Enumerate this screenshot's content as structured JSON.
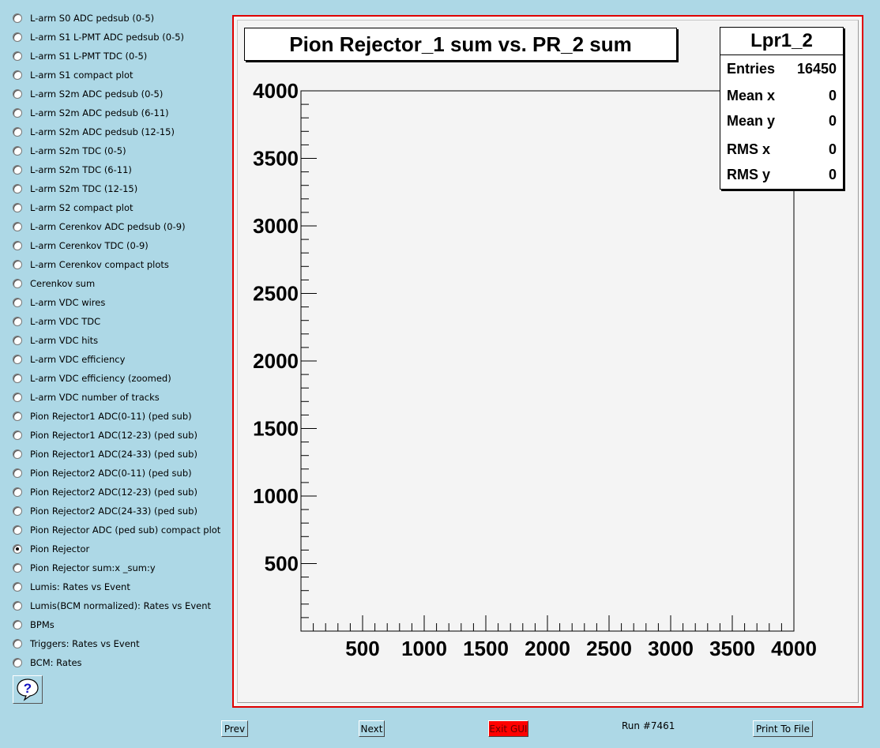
{
  "radio_items": [
    {
      "label": "L-arm S0 ADC pedsub (0-5)",
      "checked": false
    },
    {
      "label": "L-arm S1 L-PMT ADC pedsub (0-5)",
      "checked": false
    },
    {
      "label": "L-arm S1 L-PMT TDC (0-5)",
      "checked": false
    },
    {
      "label": "L-arm S1 compact plot",
      "checked": false
    },
    {
      "label": "L-arm S2m ADC pedsub (0-5)",
      "checked": false
    },
    {
      "label": "L-arm S2m ADC pedsub (6-11)",
      "checked": false
    },
    {
      "label": "L-arm S2m ADC pedsub (12-15)",
      "checked": false
    },
    {
      "label": "L-arm S2m TDC (0-5)",
      "checked": false
    },
    {
      "label": "L-arm S2m TDC (6-11)",
      "checked": false
    },
    {
      "label": "L-arm S2m TDC (12-15)",
      "checked": false
    },
    {
      "label": "L-arm S2 compact plot",
      "checked": false
    },
    {
      "label": "L-arm Cerenkov ADC pedsub (0-9)",
      "checked": false
    },
    {
      "label": "L-arm Cerenkov TDC (0-9)",
      "checked": false
    },
    {
      "label": "L-arm Cerenkov compact plots",
      "checked": false
    },
    {
      "label": "Cerenkov sum",
      "checked": false
    },
    {
      "label": "L-arm VDC wires",
      "checked": false
    },
    {
      "label": "L-arm VDC TDC",
      "checked": false
    },
    {
      "label": "L-arm VDC hits",
      "checked": false
    },
    {
      "label": "L-arm VDC efficiency",
      "checked": false
    },
    {
      "label": "L-arm VDC efficiency (zoomed)",
      "checked": false
    },
    {
      "label": "L-arm VDC number of tracks",
      "checked": false
    },
    {
      "label": "Pion Rejector1 ADC(0-11) (ped sub)",
      "checked": false
    },
    {
      "label": "Pion Rejector1 ADC(12-23) (ped sub)",
      "checked": false
    },
    {
      "label": "Pion Rejector1 ADC(24-33) (ped sub)",
      "checked": false
    },
    {
      "label": "Pion Rejector2 ADC(0-11) (ped sub)",
      "checked": false
    },
    {
      "label": "Pion Rejector2 ADC(12-23) (ped sub)",
      "checked": false
    },
    {
      "label": "Pion Rejector2 ADC(24-33) (ped sub)",
      "checked": false
    },
    {
      "label": "Pion Rejector ADC (ped sub) compact plot",
      "checked": false
    },
    {
      "label": "Pion Rejector",
      "checked": true
    },
    {
      "label": "Pion Rejector sum:x _sum:y",
      "checked": false
    },
    {
      "label": "Lumis: Rates vs Event",
      "checked": false
    },
    {
      "label": "Lumis(BCM normalized): Rates vs Event",
      "checked": false
    },
    {
      "label": "BPMs",
      "checked": false
    },
    {
      "label": "Triggers: Rates vs Event",
      "checked": false
    },
    {
      "label": "BCM: Rates",
      "checked": false
    }
  ],
  "help_icon": "question-mark-icon",
  "plot": {
    "title": "Pion Rejector_1 sum vs. PR_2 sum",
    "stats": {
      "name": "Lpr1_2",
      "rows": [
        {
          "label": "Entries",
          "value": "16450"
        },
        {
          "label": "Mean x",
          "value": "0"
        },
        {
          "label": "Mean y",
          "value": "0"
        },
        {
          "label": "RMS x",
          "value": "0"
        },
        {
          "label": "RMS y",
          "value": "0"
        }
      ]
    }
  },
  "chart_data": {
    "type": "heatmap",
    "title": "Pion Rejector_1 sum vs. PR_2 sum",
    "xlabel": "",
    "ylabel": "",
    "xlim": [
      0,
      4000
    ],
    "ylim": [
      0,
      4000
    ],
    "x_ticks": [
      500,
      1000,
      1500,
      2000,
      2500,
      3000,
      3500,
      4000
    ],
    "y_ticks": [
      500,
      1000,
      1500,
      2000,
      2500,
      3000,
      3500,
      4000
    ],
    "grid": false,
    "values": []
  },
  "buttons": {
    "prev": "Prev",
    "next": "Next",
    "exit": "Exit GUI",
    "print": "Print To File"
  },
  "run_label": "Run #7461",
  "colors": {
    "background": "#add8e6",
    "frame_border": "#e00000",
    "exit_button": "#ff0000"
  }
}
